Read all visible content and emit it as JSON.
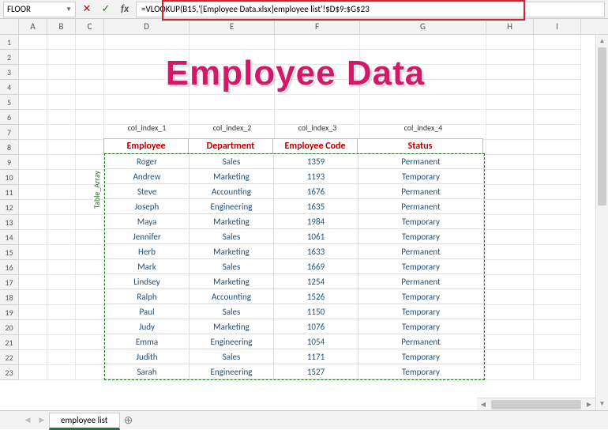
{
  "formula_bar": {
    "name_box": "FLOOR",
    "formula": "=VLOOKUP(B15,'[Employee Data.xlsx]employee list'!$D$9:$G$23"
  },
  "column_headers": [
    "A",
    "B",
    "C",
    "D",
    "E",
    "F",
    "G",
    "H",
    "I"
  ],
  "row_numbers": [
    "1",
    "2",
    "3",
    "4",
    "5",
    "6",
    "7",
    "8",
    "9",
    "10",
    "11",
    "12",
    "13",
    "14",
    "15",
    "16",
    "17",
    "18",
    "19",
    "20",
    "21",
    "22",
    "23"
  ],
  "title": "Employee Data",
  "index_labels": [
    "col_index_1",
    "col_index_2",
    "col_index_3",
    "col_index_4"
  ],
  "table_array_label": "Table_Array",
  "headers": [
    "Employee",
    "Department",
    "Employee Code",
    "Status"
  ],
  "rows": [
    {
      "emp": "Roger",
      "dept": "Sales",
      "code": "1359",
      "status": "Permanent"
    },
    {
      "emp": "Andrew",
      "dept": "Marketing",
      "code": "1193",
      "status": "Temporary"
    },
    {
      "emp": "Steve",
      "dept": "Accounting",
      "code": "1676",
      "status": "Permanent"
    },
    {
      "emp": "Joseph",
      "dept": "Engineering",
      "code": "1635",
      "status": "Permanent"
    },
    {
      "emp": "Maya",
      "dept": "Marketing",
      "code": "1984",
      "status": "Temporary"
    },
    {
      "emp": "Jennifer",
      "dept": "Sales",
      "code": "1061",
      "status": "Temporary"
    },
    {
      "emp": "Herb",
      "dept": "Marketing",
      "code": "1633",
      "status": "Permanent"
    },
    {
      "emp": "Mark",
      "dept": "Sales",
      "code": "1669",
      "status": "Temporary"
    },
    {
      "emp": "Lindsey",
      "dept": "Marketing",
      "code": "1254",
      "status": "Permanent"
    },
    {
      "emp": "Ralph",
      "dept": "Accounting",
      "code": "1526",
      "status": "Temporary"
    },
    {
      "emp": "Paul",
      "dept": "Sales",
      "code": "1150",
      "status": "Temporary"
    },
    {
      "emp": "Judy",
      "dept": "Marketing",
      "code": "1076",
      "status": "Temporary"
    },
    {
      "emp": "Emma",
      "dept": "Engineering",
      "code": "1054",
      "status": "Permanent"
    },
    {
      "emp": "Judith",
      "dept": "Sales",
      "code": "1171",
      "status": "Temporary"
    },
    {
      "emp": "Sarah",
      "dept": "Engineering",
      "code": "1527",
      "status": "Temporary"
    }
  ],
  "sheet_tab": "employee list"
}
